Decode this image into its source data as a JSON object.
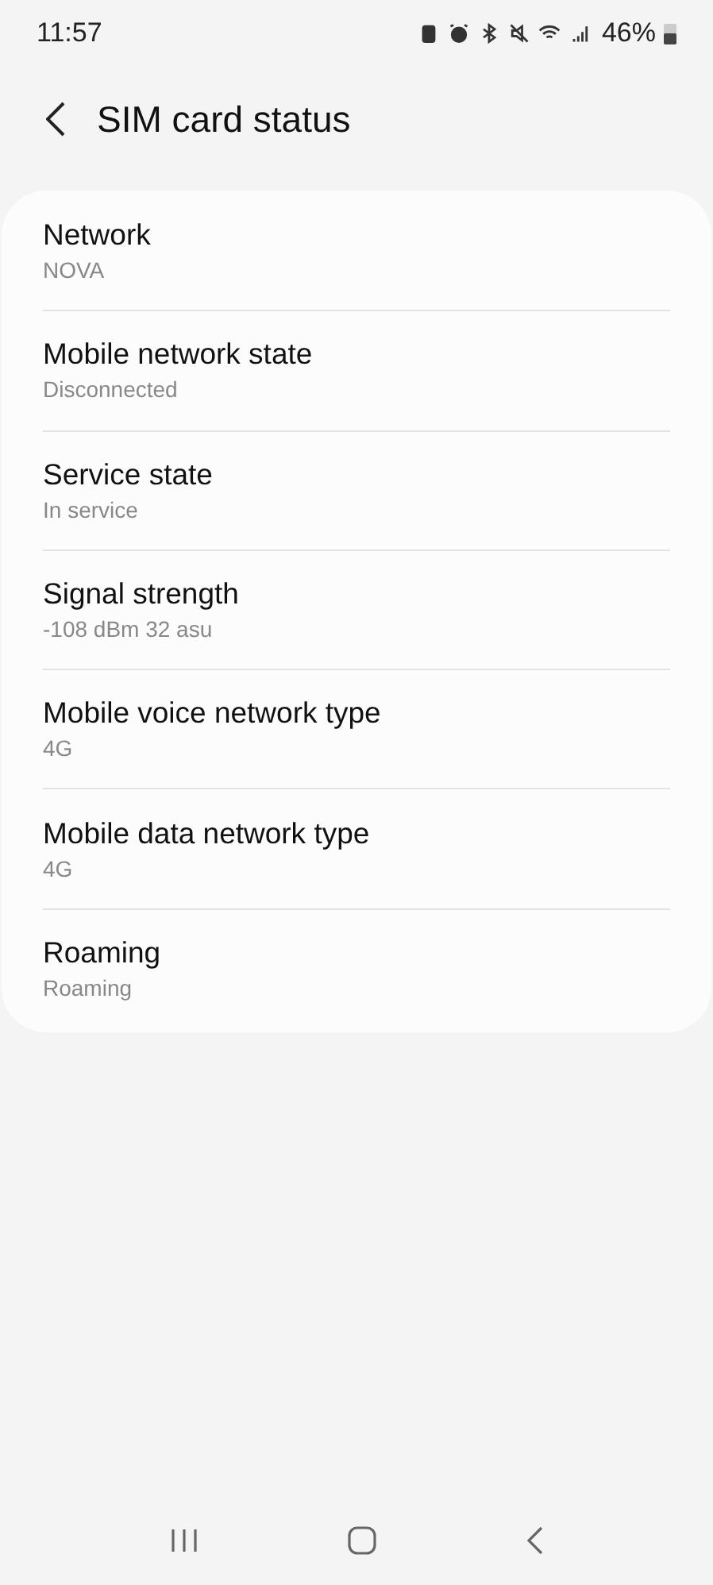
{
  "status_bar": {
    "time": "11:57",
    "battery": "46%"
  },
  "header": {
    "title": "SIM card status"
  },
  "items": [
    {
      "title": "Network",
      "value": "NOVA"
    },
    {
      "title": "Mobile network state",
      "value": "Disconnected"
    },
    {
      "title": "Service state",
      "value": "In service"
    },
    {
      "title": "Signal strength",
      "value": "-108 dBm 32 asu"
    },
    {
      "title": "Mobile voice network type",
      "value": "4G"
    },
    {
      "title": "Mobile data network type",
      "value": "4G"
    },
    {
      "title": "Roaming",
      "value": "Roaming"
    }
  ]
}
